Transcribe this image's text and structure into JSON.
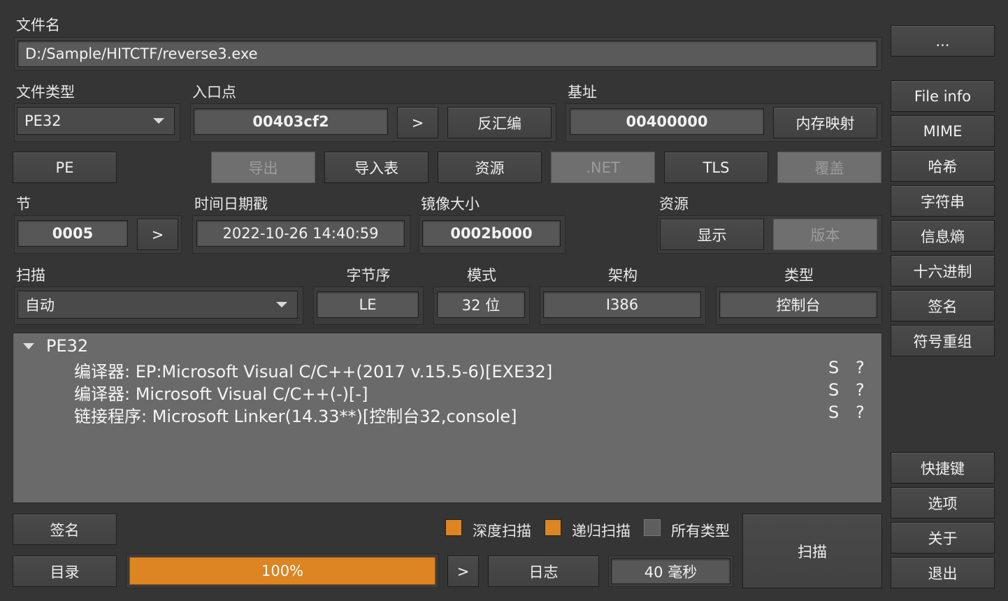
{
  "file": {
    "label": "文件名",
    "path": "D:/Sample/HITCTF/reverse3.exe",
    "browse_button": "..."
  },
  "labels": {
    "file_type": "文件类型",
    "entry_point": "入口点",
    "base": "基址",
    "sections": "节",
    "timestamp": "时间日期戳",
    "image_size": "镜像大小",
    "resources": "资源",
    "scan": "扫描",
    "endianness": "字节序",
    "mode": "模式",
    "arch": "架构",
    "type": "类型"
  },
  "values": {
    "file_type": "PE32",
    "entry_point": "00403cf2",
    "base": "00400000",
    "sections": "0005",
    "timestamp": "2022-10-26 14:40:59",
    "image_size": "0002b000",
    "scan_mode": "自动",
    "endianness": "LE",
    "mode": "32 位",
    "arch": "I386",
    "type": "控制台"
  },
  "buttons": {
    "ep_go": ">",
    "disasm": "反汇编",
    "memmap": "内存映射",
    "pe": "PE",
    "export": "导出",
    "import": "导入表",
    "resources": "资源",
    "dotnet": ".NET",
    "tls": "TLS",
    "overlay": "覆盖",
    "sections_go": ">",
    "res_show": "显示",
    "res_version": "版本",
    "signatures": "签名",
    "directory": "目录",
    "progress_go": ">",
    "log": "日志",
    "scan": "扫描"
  },
  "sidebar": {
    "top": [
      "File info",
      "MIME",
      "哈希",
      "字符串",
      "信息熵",
      "十六进制",
      "签名",
      "符号重组"
    ],
    "bottom": [
      "快捷键",
      "选项",
      "关于",
      "退出"
    ]
  },
  "results": {
    "root": "PE32",
    "items": [
      {
        "text": "编译器: EP:Microsoft Visual C/C++(2017 v.15.5-6)[EXE32]",
        "s": "S",
        "q": "?"
      },
      {
        "text": "编译器: Microsoft Visual C/C++(-)[-]",
        "s": "S",
        "q": "?"
      },
      {
        "text": "链接程序: Microsoft Linker(14.33**)[控制台32,console]",
        "s": "S",
        "q": "?"
      }
    ]
  },
  "options": {
    "deep_scan": "深度扫描",
    "recursive_scan": "递归扫描",
    "all_types": "所有类型"
  },
  "option_states": {
    "deep_scan": true,
    "recursive_scan": true,
    "all_types": false
  },
  "progress": {
    "value": 1.0,
    "text": "100%"
  },
  "elapsed": "40 毫秒",
  "colors": {
    "accent": "#dc8522",
    "background": "#353535"
  }
}
